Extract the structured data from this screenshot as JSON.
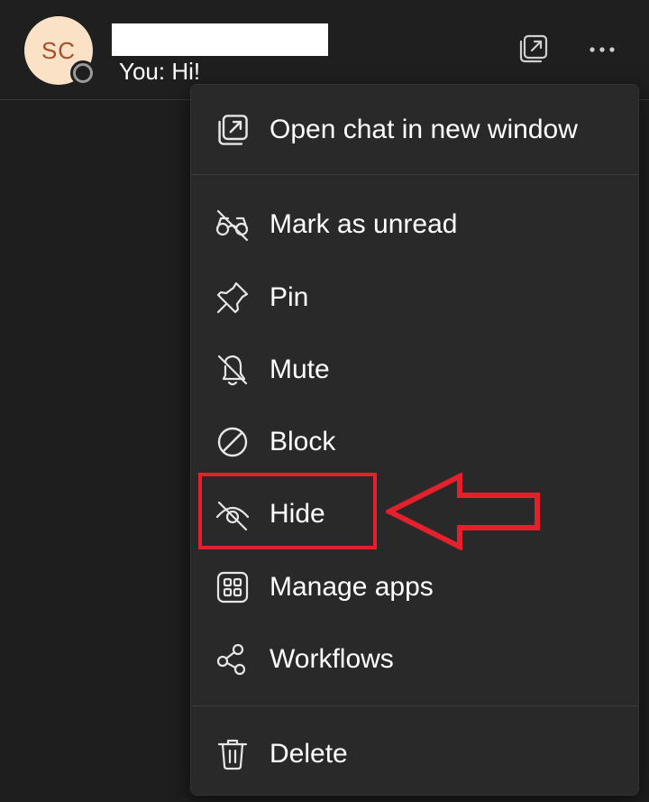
{
  "header": {
    "avatar_initials": "SC",
    "preview_text": "You: Hi!",
    "popout_icon": "popout-icon",
    "more_icon": "more-options-icon"
  },
  "menu": {
    "items": [
      {
        "label": "Open chat in new window",
        "icon": "popout-icon"
      },
      {
        "label": "Mark as unread",
        "icon": "mark-unread-icon"
      },
      {
        "label": "Pin",
        "icon": "pin-icon"
      },
      {
        "label": "Mute",
        "icon": "bell-off-icon"
      },
      {
        "label": "Block",
        "icon": "block-icon"
      },
      {
        "label": "Hide",
        "icon": "eye-off-icon"
      },
      {
        "label": "Manage apps",
        "icon": "apps-grid-icon"
      },
      {
        "label": "Workflows",
        "icon": "workflows-icon"
      },
      {
        "label": "Delete",
        "icon": "trash-icon"
      }
    ]
  },
  "colors": {
    "background": "#1e1e1e",
    "menu_bg": "#292929",
    "avatar_bg": "#fbe2c6",
    "avatar_text": "#a0522d",
    "annotation_red": "#e3202c"
  }
}
